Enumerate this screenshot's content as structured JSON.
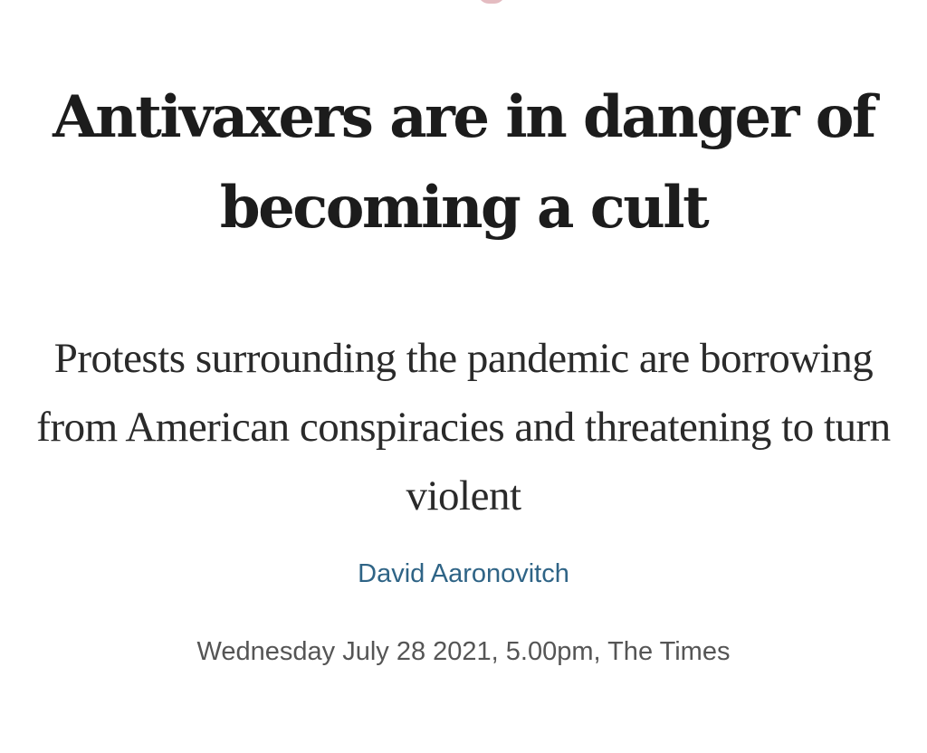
{
  "article": {
    "headline": "Antivaxers are in danger of becoming a cult",
    "standfirst": "Protests surrounding the pandemic are borrowing from American conspiracies and threatening to turn violent",
    "author": "David Aaronovitch",
    "dateline": "Wednesday July 28 2021, 5.00pm, The Times"
  },
  "colors": {
    "headline": "#1c1c1c",
    "standfirst": "#2a2a2a",
    "author_link": "#2f6486",
    "dateline": "#555555",
    "background": "#ffffff"
  }
}
